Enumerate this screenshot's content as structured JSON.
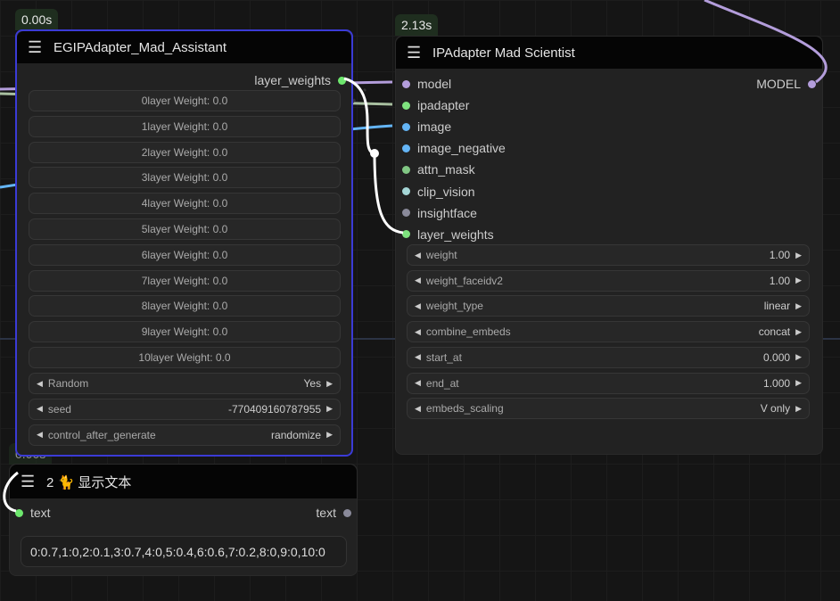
{
  "node1": {
    "badge": "0.00s",
    "title": "EGIPAdapter_Mad_Assistant",
    "output": "layer_weights",
    "widgets": [
      "0layer Weight: 0.0",
      "1layer Weight: 0.0",
      "2layer Weight: 0.0",
      "3layer Weight: 0.0",
      "4layer Weight: 0.0",
      "5layer Weight: 0.0",
      "6layer Weight: 0.0",
      "7layer Weight: 0.0",
      "8layer Weight: 0.0",
      "9layer Weight: 0.0",
      "10layer Weight: 0.0"
    ],
    "combos": [
      {
        "label": "Random",
        "value": "Yes"
      },
      {
        "label": "seed",
        "value": "-770409160787955"
      },
      {
        "label": "control_after_generate",
        "value": "randomize"
      }
    ]
  },
  "node2": {
    "badge": "2.13s",
    "title": "IPAdapter Mad Scientist",
    "output": "MODEL",
    "inputs": [
      {
        "label": "model",
        "color": "#b39ddb"
      },
      {
        "label": "ipadapter",
        "color": "#7ee27e"
      },
      {
        "label": "image",
        "color": "#64b5f6"
      },
      {
        "label": "image_negative",
        "color": "#64b5f6"
      },
      {
        "label": "attn_mask",
        "color": "#81c784"
      },
      {
        "label": "clip_vision",
        "color": "#a5d6d6"
      },
      {
        "label": "insightface",
        "color": "#8a8a9a"
      },
      {
        "label": "layer_weights",
        "color": "#7ee27e"
      }
    ],
    "widgets": [
      {
        "label": "weight",
        "value": "1.00"
      },
      {
        "label": "weight_faceidv2",
        "value": "1.00"
      },
      {
        "label": "weight_type",
        "value": "linear"
      },
      {
        "label": "combine_embeds",
        "value": "concat"
      },
      {
        "label": "start_at",
        "value": "0.000"
      },
      {
        "label": "end_at",
        "value": "1.000"
      },
      {
        "label": "embeds_scaling",
        "value": "V only"
      }
    ]
  },
  "node3": {
    "badge": "0.00s",
    "title": "2 🐈 显示文本",
    "input": "text",
    "output": "text",
    "text_value": "0:0.7,1:0,2:0.1,3:0.7,4:0,5:0.4,6:0.6,7:0.2,8:0,9:0,10:0"
  },
  "colors": {
    "selected_border": "#3b3bd6",
    "link_white": "#ffffff",
    "link_purple": "#b39ddb",
    "link_blue": "#64b5f6",
    "link_green": "#a8bfa0"
  }
}
